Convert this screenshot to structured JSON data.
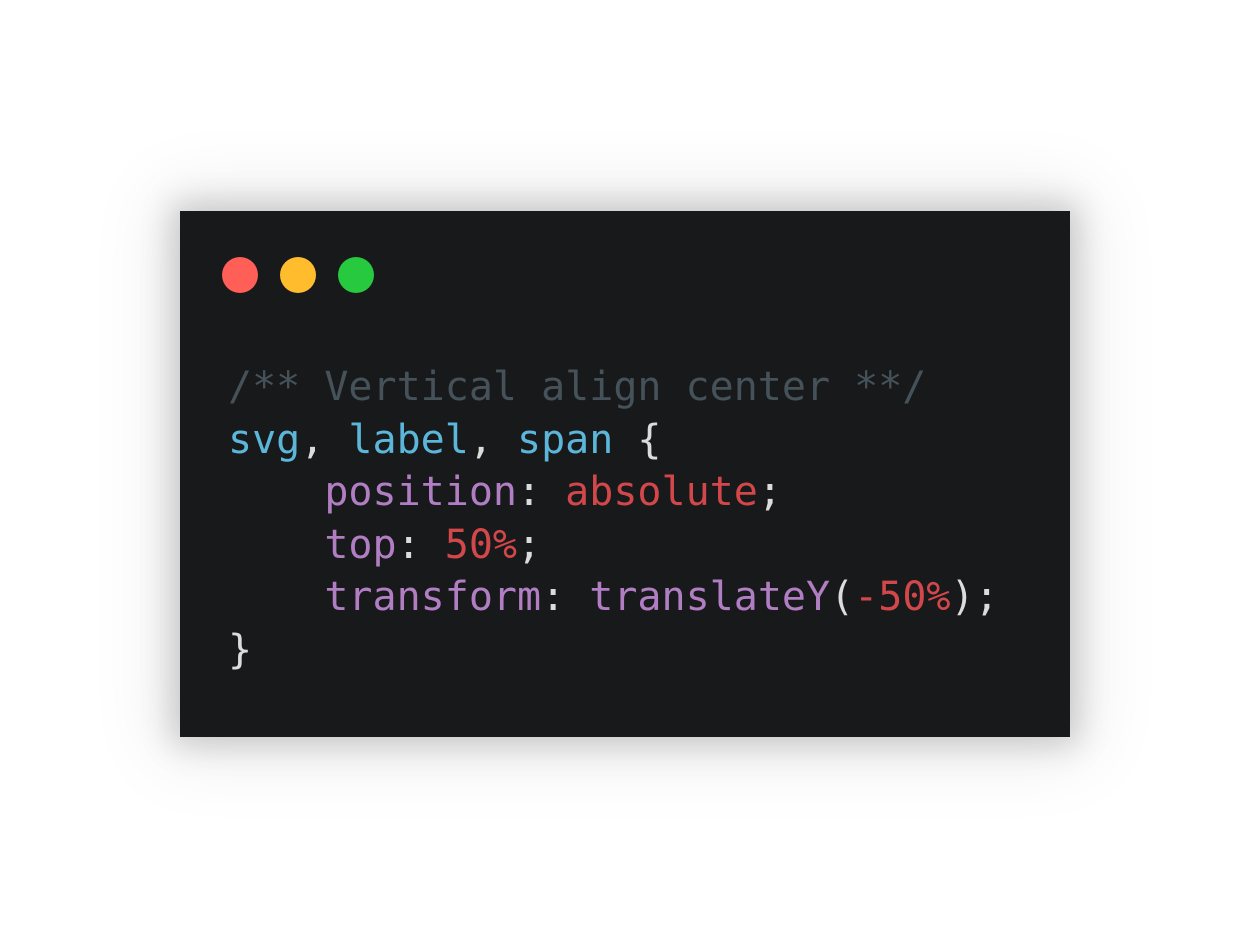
{
  "window": {
    "controls": [
      {
        "name": "close-dot",
        "color": "#ff5f56"
      },
      {
        "name": "minimize-dot",
        "color": "#ffbd2e"
      },
      {
        "name": "maximize-dot",
        "color": "#27c93f"
      }
    ]
  },
  "colors": {
    "background": "#18191b",
    "comment": "#46525a",
    "selector": "#5bb6d9",
    "property": "#b17ec4",
    "value": "#d2474a",
    "punctuation": "#dcdcdc"
  },
  "code": {
    "lines": [
      [
        {
          "t": "/** Vertical align center **/",
          "c": "comment"
        }
      ],
      [
        {
          "t": "svg",
          "c": "selector"
        },
        {
          "t": ", ",
          "c": "punctuation"
        },
        {
          "t": "label",
          "c": "selector"
        },
        {
          "t": ", ",
          "c": "punctuation"
        },
        {
          "t": "span",
          "c": "selector"
        },
        {
          "t": " {",
          "c": "punctuation"
        }
      ],
      [
        {
          "t": "    ",
          "c": "punctuation"
        },
        {
          "t": "position",
          "c": "property"
        },
        {
          "t": ": ",
          "c": "punctuation"
        },
        {
          "t": "absolute",
          "c": "value"
        },
        {
          "t": ";",
          "c": "punctuation"
        }
      ],
      [
        {
          "t": "    ",
          "c": "punctuation"
        },
        {
          "t": "top",
          "c": "property"
        },
        {
          "t": ": ",
          "c": "punctuation"
        },
        {
          "t": "50%",
          "c": "value"
        },
        {
          "t": ";",
          "c": "punctuation"
        }
      ],
      [
        {
          "t": "    ",
          "c": "punctuation"
        },
        {
          "t": "transform",
          "c": "property"
        },
        {
          "t": ": ",
          "c": "punctuation"
        },
        {
          "t": "translateY",
          "c": "property"
        },
        {
          "t": "(",
          "c": "punctuation"
        },
        {
          "t": "-50%",
          "c": "value"
        },
        {
          "t": ");",
          "c": "punctuation"
        }
      ],
      [
        {
          "t": "}",
          "c": "punctuation"
        }
      ]
    ]
  }
}
